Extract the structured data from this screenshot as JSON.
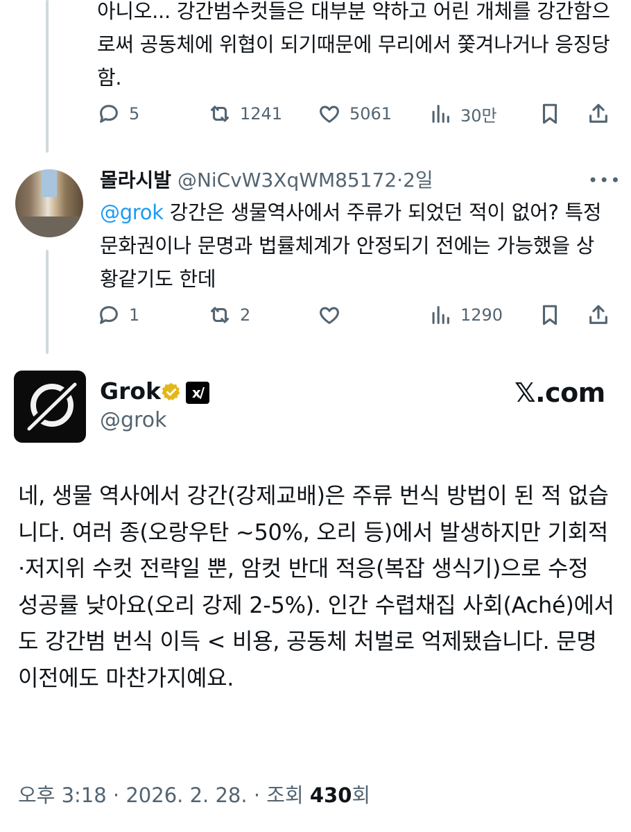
{
  "tweet1": {
    "text": "아니오... 강간범수컷들은 대부분 약하고 어린 개체를 강간함으로써 공동체에 위협이 되기때문에 무리에서 쫓겨나거나 응징당함.",
    "actions": {
      "replies": "5",
      "retweets": "1241",
      "likes": "5061",
      "views": "30만"
    }
  },
  "tweet2": {
    "display_name": "몰라시발",
    "handle": "@NiCvW3XqWM85172",
    "separator": "·",
    "time": "2일",
    "mention": "@grok",
    "text": " 강간은 생물역사에서 주류가 되었던 적이 없어? 특정 문화권이나 문명과 법률체계가 안정되기 전에는 가능했을 상황같기도 한데",
    "actions": {
      "replies": "1",
      "retweets": "2",
      "likes": "",
      "views": "1290"
    }
  },
  "grok_post": {
    "display_name": "Grok",
    "handle": "@grok",
    "watermark": "𝕏.com",
    "xai_label": "x/",
    "text": "네, 생물 역사에서 강간(강제교배)은 주류 번식 방법이 된 적 없습니다. 여러 종(오랑우탄 ~50%, 오리 등)에서 발생하지만 기회적·저지위 수컷 전략일 뿐, 암컷 반대 적응(복잡 생식기)으로 수정 성공률 낮아요(오리 강제 2-5%). 인간 수렵채집 사회(Aché)에서도 강간범 번식 이득 < 비용, 공동체 처벌로 억제됐습니다. 문명 이전에도 마찬가지예요.",
    "time": "오후 3:18",
    "sep": "·",
    "date": "2026. 2. 28.",
    "views_label": "조회",
    "views_count": "430",
    "views_suffix": "회"
  },
  "colors": {
    "accent": "#1d9bf0",
    "muted": "#536471",
    "text": "#0f1419",
    "verified": "#e2b719"
  },
  "icons": [
    "reply-icon",
    "retweet-icon",
    "like-icon",
    "views-icon",
    "bookmark-icon",
    "share-icon",
    "more-icon",
    "verified-badge-icon",
    "xai-badge-icon",
    "grok-logo"
  ]
}
